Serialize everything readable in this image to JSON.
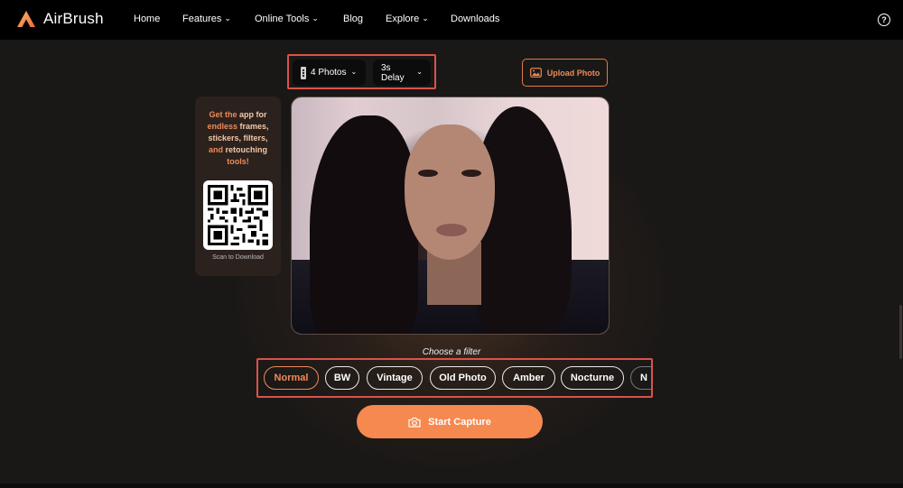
{
  "nav": {
    "brand": "AirBrush",
    "items": [
      {
        "label": "Home"
      },
      {
        "label": "Features",
        "has_dropdown": true
      },
      {
        "label": "Online Tools",
        "has_dropdown": true
      },
      {
        "label": "Blog"
      },
      {
        "label": "Explore",
        "has_dropdown": true
      },
      {
        "label": "Downloads"
      }
    ],
    "help_symbol": "?",
    "icons": {
      "logo": "airbrush-logo",
      "help": "question-circle-icon"
    }
  },
  "controls": {
    "photos_select": "4 Photos",
    "delay_select": "3s Delay",
    "upload_label": "Upload Photo",
    "icons": {
      "photos": "film-strip-icon",
      "upload": "image-icon",
      "dropdown": "chevron-down-icon"
    }
  },
  "promo": {
    "line_parts": [
      "Get the ",
      "app for",
      " endless ",
      "frames,",
      " ",
      "stickers, filters,",
      " and ",
      "retouching",
      " ",
      "tools!"
    ],
    "caption": "Scan to Download"
  },
  "filters": {
    "title": "Choose a filter",
    "selected": "Normal",
    "items": [
      "Normal",
      "BW",
      "Vintage",
      "Old Photo",
      "Amber",
      "Nocturne",
      "N"
    ]
  },
  "capture": {
    "label": "Start Capture",
    "icon": "camera-icon"
  },
  "colors": {
    "accent": "#f5894f",
    "highlight_box": "#d9534a",
    "background": "#1a1817",
    "nav": "#000000"
  }
}
